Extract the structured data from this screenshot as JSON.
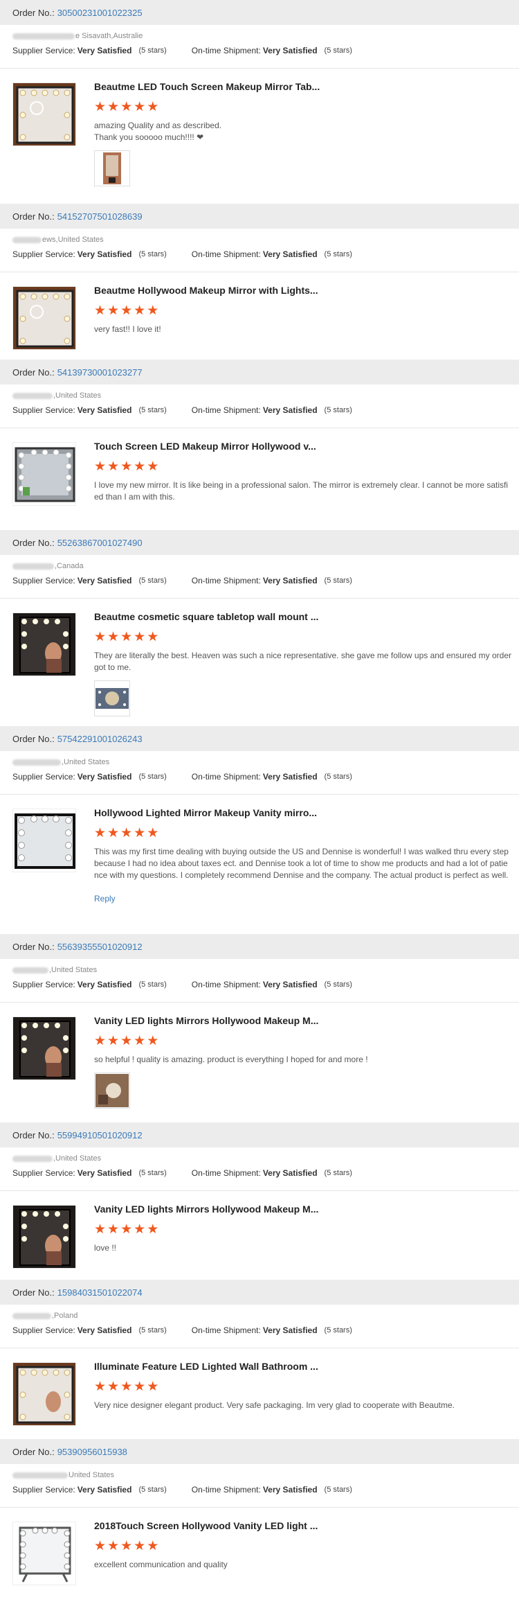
{
  "labels": {
    "order_no": "Order No.:",
    "supplier_service": "Supplier Service:",
    "ontime_shipment": "On-time Shipment:"
  },
  "colors": {
    "accent_orange": "#f0581e",
    "link_blue": "#3a7ab8",
    "bar_gray": "#ececec"
  },
  "reviews": [
    {
      "order_no": "3050023100102232​5",
      "buyer_suffix": "e Sisavath,Australie",
      "supplier_value": "Very Satisfied",
      "supplier_stars": "(5 stars)",
      "shipment_value": "Very Satisfied",
      "shipment_stars": "(5 stars)",
      "product_title": "Beautme LED Touch Screen Makeup Mirror Tab...",
      "rating": 5,
      "text": "amazing Quality and as described.\nThank you sooooo much!!!! ❤",
      "has_photo": true,
      "reply": ""
    },
    {
      "order_no": "54152707501028639",
      "buyer_suffix": "ews,United States",
      "supplier_value": "Very Satisfied",
      "supplier_stars": "(5 stars)",
      "shipment_value": "Very Satisfied",
      "shipment_stars": "(5 stars)",
      "product_title": "Beautme Hollywood Makeup Mirror with Lights...",
      "rating": 5,
      "text": "very fast!! I love it!",
      "has_photo": false,
      "reply": ""
    },
    {
      "order_no": "54139730001023277",
      "buyer_suffix": ",United States",
      "supplier_value": "Very Satisfied",
      "supplier_stars": "(5 stars)",
      "shipment_value": "Very Satisfied",
      "shipment_stars": "(5 stars)",
      "product_title": "Touch Screen LED Makeup Mirror Hollywood v...",
      "rating": 5,
      "text": "I love my new mirror.  It is like being in a professional salon.  The mirror is extremely clear.  I cannot be more satisfied than I am with this.",
      "has_photo": false,
      "reply": ""
    },
    {
      "order_no": "55263867001027490",
      "buyer_suffix": ",Canada",
      "supplier_value": "Very Satisfied",
      "supplier_stars": "(5 stars)",
      "shipment_value": "Very Satisfied",
      "shipment_stars": "(5 stars)",
      "product_title": "Beautme cosmetic square tabletop wall mount ...",
      "rating": 5,
      "text": "They are literally the best. Heaven was such a nice representative. she gave me follow ups and ensured my order got to me.",
      "has_photo": true,
      "reply": ""
    },
    {
      "order_no": "57542291001026243",
      "buyer_suffix": ",United States",
      "supplier_value": "Very Satisfied",
      "supplier_stars": "(5 stars)",
      "shipment_value": "Very Satisfied",
      "shipment_stars": "(5 stars)",
      "product_title": "Hollywood Lighted Mirror Makeup Vanity mirro...",
      "rating": 5,
      "text": "This was my first time dealing with buying outside the US and Dennise is wonderful! I was walked thru every step because I had no idea about taxes ect. and Dennise took a lot of time to show me products and had a lot of patience with my questions. I completely recommend Dennise and the company. The actual product is perfect as well.",
      "has_photo": false,
      "reply": "Reply"
    },
    {
      "order_no": "55639355501020912",
      "buyer_suffix": ",United States",
      "supplier_value": "Very Satisfied",
      "supplier_stars": "(5 stars)",
      "shipment_value": "Very Satisfied",
      "shipment_stars": "(5 stars)",
      "product_title": "Vanity LED lights Mirrors Hollywood Makeup M...",
      "rating": 5,
      "text": "so helpful ! quality is amazing. product is everything I hoped for and more !",
      "has_photo": true,
      "reply": ""
    },
    {
      "order_no": "55994910501020912",
      "buyer_suffix": ",United States",
      "supplier_value": "Very Satisfied",
      "supplier_stars": "(5 stars)",
      "shipment_value": "Very Satisfied",
      "shipment_stars": "(5 stars)",
      "product_title": "Vanity LED lights Mirrors Hollywood Makeup M...",
      "rating": 5,
      "text": "love !!",
      "has_photo": false,
      "reply": ""
    },
    {
      "order_no": "15984031501022074",
      "buyer_suffix": ",Poland",
      "supplier_value": "Very Satisfied",
      "supplier_stars": "(5 stars)",
      "shipment_value": "Very Satisfied",
      "shipment_stars": "(5 stars)",
      "product_title": "Illuminate Feature LED Lighted Wall Bathroom ...",
      "rating": 5,
      "text": "Very nice designer elegant product. Very safe packaging. Im very glad to cooperate with Beautme.",
      "has_photo": false,
      "reply": ""
    },
    {
      "order_no": "95390956015938",
      "buyer_suffix": "United States",
      "supplier_value": "Very Satisfied",
      "supplier_stars": "(5 stars)",
      "shipment_value": "Very Satisfied",
      "shipment_stars": "(5 stars)",
      "product_title": "2018Touch Screen Hollywood Vanity LED light ...",
      "rating": 5,
      "text": "excellent communication and quality",
      "has_photo": false,
      "reply": ""
    }
  ]
}
